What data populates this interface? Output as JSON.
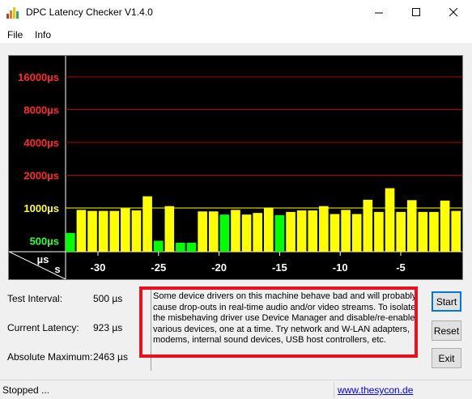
{
  "window": {
    "title": "DPC Latency Checker V1.4.0"
  },
  "menu": {
    "items": [
      "File",
      "Info"
    ]
  },
  "graph": {
    "y_labels": [
      {
        "text": "16000µs",
        "color": "#ff2a2a"
      },
      {
        "text": "8000µs",
        "color": "#ff2a2a"
      },
      {
        "text": "4000µs",
        "color": "#ff2a2a"
      },
      {
        "text": "2000µs",
        "color": "#ff2a2a"
      },
      {
        "text": "1000µs",
        "color": "#ffff33"
      },
      {
        "text": "500µs",
        "color": "#33ff33"
      }
    ],
    "unit_top": "µs",
    "unit_bottom": "s",
    "x_labels": [
      "-30",
      "-25",
      "-20",
      "-15",
      "-10",
      "-5"
    ],
    "colors": {
      "yellow": "#ffff00",
      "green": "#00ff00",
      "grid": "#b40000"
    }
  },
  "chart_data": {
    "type": "bar",
    "ylabel": "µs",
    "xlabel": "s",
    "y_scale": "log2",
    "y_ticks": [
      500,
      1000,
      2000,
      4000,
      8000,
      16000
    ],
    "x_ticks": [
      -30,
      -25,
      -20,
      -15,
      -10,
      -5
    ],
    "values": [
      590,
      960,
      940,
      940,
      940,
      990,
      950,
      1280,
      500,
      1040,
      480,
      480,
      930,
      930,
      870,
      960,
      870,
      900,
      1010,
      860,
      920,
      950,
      950,
      1040,
      880,
      960,
      880,
      1190,
      920,
      1520,
      920,
      1180,
      920,
      920,
      1170,
      940
    ],
    "bar_status": [
      "green",
      "yellow",
      "yellow",
      "yellow",
      "yellow",
      "yellow",
      "yellow",
      "yellow",
      "green",
      "yellow",
      "green",
      "green",
      "yellow",
      "yellow",
      "green",
      "yellow",
      "yellow",
      "yellow",
      "yellow",
      "green",
      "yellow",
      "yellow",
      "yellow",
      "yellow",
      "yellow",
      "yellow",
      "yellow",
      "yellow",
      "yellow",
      "yellow",
      "yellow",
      "yellow",
      "yellow",
      "yellow",
      "yellow",
      "yellow"
    ]
  },
  "stats": {
    "test_interval_label": "Test Interval:",
    "test_interval_value": "500 µs",
    "current_latency_label": "Current Latency:",
    "current_latency_value": "923 µs",
    "absolute_max_label": "Absolute Maximum:",
    "absolute_max_value": "2463 µs"
  },
  "message": "Some device drivers on this machine behave bad and will probably cause drop-outs in real-time audio and/or video streams. To isolate the misbehaving driver use Device Manager and disable/re-enable various devices, one at a time. Try network and W-LAN adapters, modems, internal sound devices, USB host controllers, etc.",
  "buttons": {
    "start": "Start",
    "reset": "Reset",
    "exit": "Exit"
  },
  "status": {
    "text": "Stopped ...",
    "link": "www.thesycon.de"
  },
  "highlight_color": "#e8121c"
}
